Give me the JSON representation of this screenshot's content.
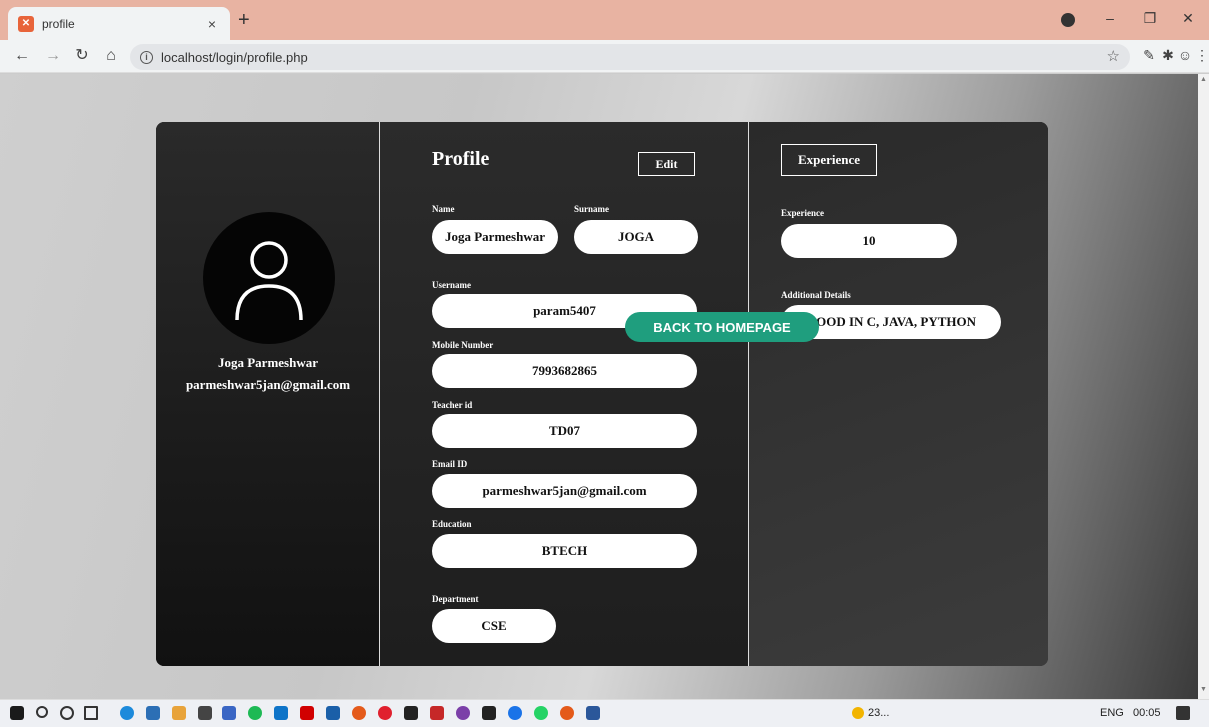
{
  "browser": {
    "tab_title": "profile",
    "tab_favicon": "xampp-icon",
    "tab_close": "×",
    "new_tab": "+",
    "url": "localhost/login/profile.php"
  },
  "profile_card": {
    "user_name": "Joga Parmeshwar",
    "user_email": "parmeshwar5jan@gmail.com"
  },
  "profile_section": {
    "title": "Profile",
    "edit_label": "Edit",
    "fields": {
      "name_label": "Name",
      "name_value": "Joga Parmeshwar",
      "surname_label": "Surname",
      "surname_value": "JOGA",
      "username_label": "Username",
      "username_value": "param5407",
      "mobile_label": "Mobile Number",
      "mobile_value": "7993682865",
      "teacher_label": "Teacher id",
      "teacher_value": "TD07",
      "email_label": "Email ID",
      "email_value": "parmeshwar5jan@gmail.com",
      "education_label": "Education",
      "education_value": "BTECH",
      "department_label": "Department",
      "department_value": "CSE"
    }
  },
  "experience_section": {
    "button_label": "Experience",
    "experience_label": "Experience",
    "experience_value": "10",
    "details_label": "Additional Details",
    "details_value": "GOOD IN C, JAVA, PYTHON",
    "home_button": "BACK TO HOMEPAGE"
  },
  "taskbar": {
    "weather": "23...",
    "language": "ENG",
    "time": "00:05"
  },
  "colors": {
    "accent": "#1f9e7e",
    "card_bg": "#232323",
    "tab_strip": "#e8b3a2"
  }
}
